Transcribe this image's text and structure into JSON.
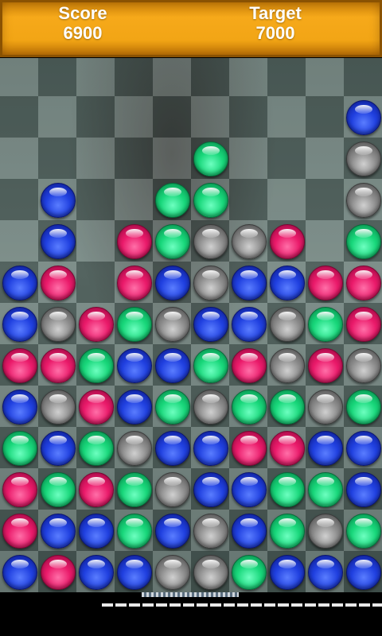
{
  "hud": {
    "score_label": "Score",
    "score_value": "6900",
    "target_label": "Target",
    "target_value": "7000"
  },
  "board": {
    "columns": 10,
    "rows": 13,
    "grid": [
      [
        "",
        "",
        "",
        "",
        "",
        "",
        "",
        "",
        "",
        ""
      ],
      [
        "",
        "",
        "",
        "",
        "",
        "",
        "",
        "",
        "",
        "blue"
      ],
      [
        "",
        "",
        "",
        "",
        "",
        "green",
        "",
        "",
        "",
        "gray"
      ],
      [
        "",
        "blue",
        "",
        "",
        "green",
        "green",
        "",
        "",
        "",
        "gray"
      ],
      [
        "",
        "blue",
        "",
        "pink",
        "green",
        "gray",
        "gray",
        "pink",
        "",
        "green"
      ],
      [
        "blue",
        "pink",
        "",
        "pink",
        "blue",
        "gray",
        "blue",
        "blue",
        "pink",
        "pink"
      ],
      [
        "blue",
        "gray",
        "pink",
        "green",
        "gray",
        "blue",
        "blue",
        "gray",
        "green",
        "pink"
      ],
      [
        "pink",
        "pink",
        "green",
        "blue",
        "blue",
        "green",
        "pink",
        "gray",
        "pink",
        "gray"
      ],
      [
        "blue",
        "gray",
        "pink",
        "blue",
        "green",
        "gray",
        "green",
        "green",
        "gray",
        "green"
      ],
      [
        "green",
        "blue",
        "green",
        "gray",
        "blue",
        "blue",
        "pink",
        "pink",
        "blue",
        "blue"
      ],
      [
        "pink",
        "green",
        "pink",
        "green",
        "gray",
        "blue",
        "blue",
        "green",
        "green",
        "blue"
      ],
      [
        "pink",
        "blue",
        "blue",
        "green",
        "blue",
        "gray",
        "blue",
        "green",
        "gray",
        "green"
      ],
      [
        "blue",
        "pink",
        "blue",
        "blue",
        "gray",
        "gray",
        "green",
        "blue",
        "blue",
        "blue"
      ]
    ]
  },
  "colors": {
    "header_orange": "#f2a515",
    "blue": "#2040e0",
    "green": "#18d77a",
    "pink": "#ea1a6a",
    "gray": "#8c8c8c"
  }
}
